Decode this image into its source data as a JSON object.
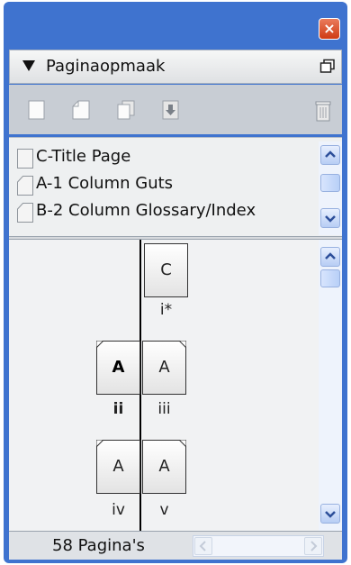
{
  "panel": {
    "title": "Paginaopmaak",
    "close_label": "×"
  },
  "toolbar": {
    "icons": [
      "new-page-icon",
      "new-master-icon",
      "duplicate-page-icon",
      "load-page-icon",
      "delete-page-icon"
    ]
  },
  "masters": [
    {
      "label": "C-Title Page"
    },
    {
      "label": "A-1 Column Guts"
    },
    {
      "label": "B-2 Column Glossary/Index"
    }
  ],
  "spreads": [
    {
      "pages": [
        {
          "master": "C",
          "number": "i*",
          "bold": false
        }
      ]
    },
    {
      "pages": [
        {
          "master": "A",
          "number": "ii",
          "bold": true
        },
        {
          "master": "A",
          "number": "iii",
          "bold": false
        }
      ]
    },
    {
      "pages": [
        {
          "master": "A",
          "number": "iv",
          "bold": false
        },
        {
          "master": "A",
          "number": "v",
          "bold": false
        }
      ]
    }
  ],
  "footer": {
    "page_count": "58 Pagina's"
  },
  "colors": {
    "panel_frame": "#3f73cf",
    "close_button": "#cf3b14"
  }
}
